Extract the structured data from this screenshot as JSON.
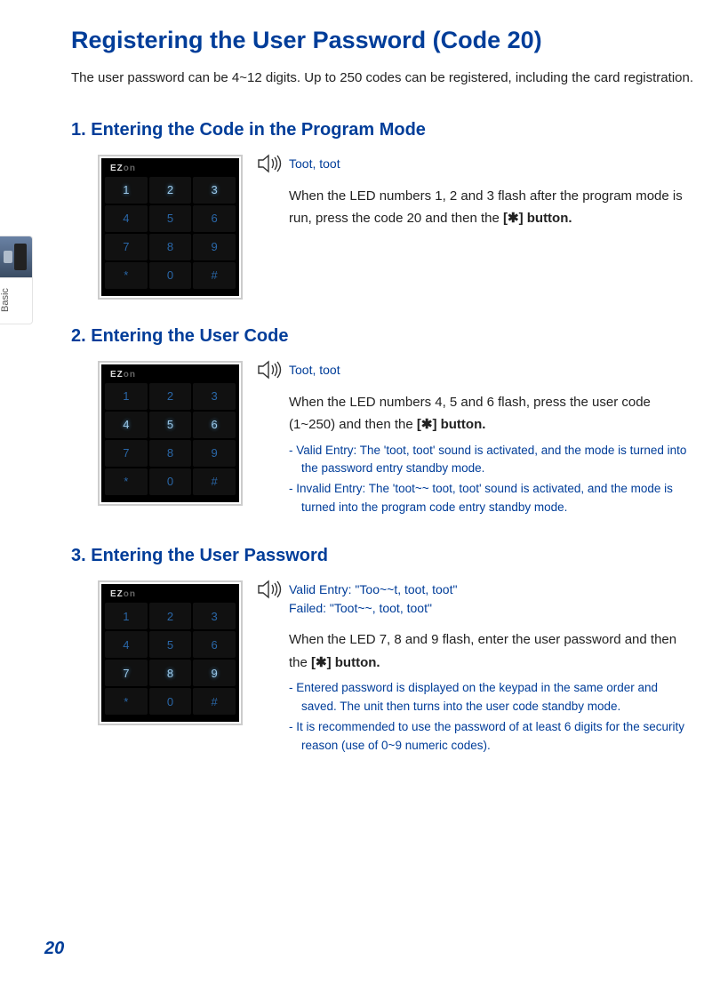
{
  "page_title": "Registering the User Password (Code 20)",
  "intro": "The user password can be 4~12 digits. Up to 250 codes can be registered, including the card registration.",
  "side_tab": {
    "label": "Basic"
  },
  "keypad_brand": "EZ",
  "keypad_brand_suffix": "on",
  "keypad_keys": [
    "1",
    "2",
    "3",
    "4",
    "5",
    "6",
    "7",
    "8",
    "9",
    "*",
    "0",
    "#"
  ],
  "steps": [
    {
      "title": "1. Entering the Code in the Program Mode",
      "flash_row": 0,
      "sound_label": "Toot, toot",
      "desc_pre": "When the LED numbers 1, 2 and 3 flash after the program mode is run, press the code 20 and then the ",
      "desc_bold": "[✱] button.",
      "notes": []
    },
    {
      "title": "2. Entering the User Code",
      "flash_row": 1,
      "sound_label": "Toot, toot",
      "desc_pre": "When the LED numbers 4, 5 and 6 flash, press the user code (1~250) and then the ",
      "desc_bold": "[✱] button.",
      "notes": [
        "- Valid Entry: The 'toot, toot' sound is activated, and the mode is turned into the password entry standby mode.",
        "- Invalid Entry: The 'toot~~ toot, toot' sound is activated, and the mode is turned into the program code entry standby mode."
      ]
    },
    {
      "title": "3. Entering the User Password",
      "flash_row": 2,
      "sound_label": "Valid Entry: \"Too~~t, toot, toot\"\nFailed: \"Toot~~, toot, toot\"",
      "desc_pre": "When the LED 7, 8 and 9 flash, enter the user password and then the ",
      "desc_bold": "[✱] button.",
      "notes": [
        "- Entered password is displayed on the keypad in the same order and saved. The unit then turns into the user code standby mode.",
        "- It is recommended to use the password of at least 6 digits for the security reason (use of 0~9 numeric codes)."
      ]
    }
  ],
  "page_number": "20"
}
